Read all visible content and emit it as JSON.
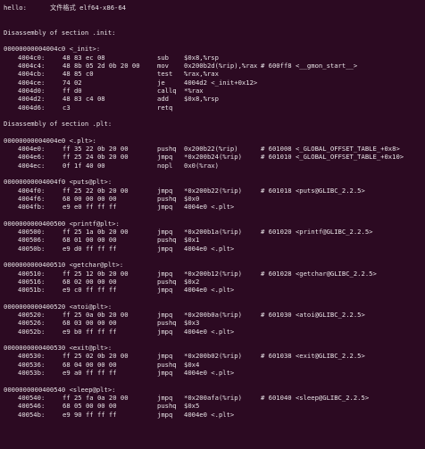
{
  "header": {
    "label": "hello:",
    "value": "文件格式 elf64-x86-64"
  },
  "sections": [
    {
      "title": "Disassembly of section .init:",
      "functions": [
        {
          "header": "00000000004004c0 <_init>:",
          "rows": [
            {
              "addr": "4004c0:",
              "bytes": "48 83 ec 08",
              "mn": "sub",
              "op": "$0x8,%rsp",
              "cm": ""
            },
            {
              "addr": "4004c4:",
              "bytes": "48 8b 05 2d 0b 20 00",
              "mn": "mov",
              "op": "0x200b2d(%rip),%rax",
              "cm": "# 600ff8 <__gmon_start__>"
            },
            {
              "addr": "4004cb:",
              "bytes": "48 85 c0",
              "mn": "test",
              "op": "%rax,%rax",
              "cm": ""
            },
            {
              "addr": "4004ce:",
              "bytes": "74 02",
              "mn": "je",
              "op": "4004d2 <_init+0x12>",
              "cm": ""
            },
            {
              "addr": "4004d0:",
              "bytes": "ff d0",
              "mn": "callq",
              "op": "*%rax",
              "cm": ""
            },
            {
              "addr": "4004d2:",
              "bytes": "48 83 c4 08",
              "mn": "add",
              "op": "$0x8,%rsp",
              "cm": ""
            },
            {
              "addr": "4004d6:",
              "bytes": "c3",
              "mn": "retq",
              "op": "",
              "cm": ""
            }
          ]
        }
      ]
    },
    {
      "title": "Disassembly of section .plt:",
      "functions": [
        {
          "header": "00000000004004e0 <.plt>:",
          "rows": [
            {
              "addr": "4004e0:",
              "bytes": "ff 35 22 0b 20 00",
              "mn": "pushq",
              "op": "0x200b22(%rip)",
              "cm": "# 601008 <_GLOBAL_OFFSET_TABLE_+0x8>"
            },
            {
              "addr": "4004e6:",
              "bytes": "ff 25 24 0b 20 00",
              "mn": "jmpq",
              "op": "*0x200b24(%rip)",
              "cm": "# 601010 <_GLOBAL_OFFSET_TABLE_+0x10>"
            },
            {
              "addr": "4004ec:",
              "bytes": "0f 1f 40 00",
              "mn": "nopl",
              "op": "0x0(%rax)",
              "cm": ""
            }
          ]
        },
        {
          "header": "00000000004004f0 <puts@plt>:",
          "rows": [
            {
              "addr": "4004f0:",
              "bytes": "ff 25 22 0b 20 00",
              "mn": "jmpq",
              "op": "*0x200b22(%rip)",
              "cm": "# 601018 <puts@GLIBC_2.2.5>"
            },
            {
              "addr": "4004f6:",
              "bytes": "68 00 00 00 00",
              "mn": "pushq",
              "op": "$0x0",
              "cm": ""
            },
            {
              "addr": "4004fb:",
              "bytes": "e9 e0 ff ff ff",
              "mn": "jmpq",
              "op": "4004e0 <.plt>",
              "cm": ""
            }
          ]
        },
        {
          "header": "0000000000400500 <printf@plt>:",
          "rows": [
            {
              "addr": "400500:",
              "bytes": "ff 25 1a 0b 20 00",
              "mn": "jmpq",
              "op": "*0x200b1a(%rip)",
              "cm": "# 601020 <printf@GLIBC_2.2.5>"
            },
            {
              "addr": "400506:",
              "bytes": "68 01 00 00 00",
              "mn": "pushq",
              "op": "$0x1",
              "cm": ""
            },
            {
              "addr": "40050b:",
              "bytes": "e9 d0 ff ff ff",
              "mn": "jmpq",
              "op": "4004e0 <.plt>",
              "cm": ""
            }
          ]
        },
        {
          "header": "0000000000400510 <getchar@plt>:",
          "rows": [
            {
              "addr": "400510:",
              "bytes": "ff 25 12 0b 20 00",
              "mn": "jmpq",
              "op": "*0x200b12(%rip)",
              "cm": "# 601028 <getchar@GLIBC_2.2.5>"
            },
            {
              "addr": "400516:",
              "bytes": "68 02 00 00 00",
              "mn": "pushq",
              "op": "$0x2",
              "cm": ""
            },
            {
              "addr": "40051b:",
              "bytes": "e9 c0 ff ff ff",
              "mn": "jmpq",
              "op": "4004e0 <.plt>",
              "cm": ""
            }
          ]
        },
        {
          "header": "0000000000400520 <atoi@plt>:",
          "rows": [
            {
              "addr": "400520:",
              "bytes": "ff 25 0a 0b 20 00",
              "mn": "jmpq",
              "op": "*0x200b0a(%rip)",
              "cm": "# 601030 <atoi@GLIBC_2.2.5>"
            },
            {
              "addr": "400526:",
              "bytes": "68 03 00 00 00",
              "mn": "pushq",
              "op": "$0x3",
              "cm": ""
            },
            {
              "addr": "40052b:",
              "bytes": "e9 b0 ff ff ff",
              "mn": "jmpq",
              "op": "4004e0 <.plt>",
              "cm": ""
            }
          ]
        },
        {
          "header": "0000000000400530 <exit@plt>:",
          "rows": [
            {
              "addr": "400530:",
              "bytes": "ff 25 02 0b 20 00",
              "mn": "jmpq",
              "op": "*0x200b02(%rip)",
              "cm": "# 601038 <exit@GLIBC_2.2.5>"
            },
            {
              "addr": "400536:",
              "bytes": "68 04 00 00 00",
              "mn": "pushq",
              "op": "$0x4",
              "cm": ""
            },
            {
              "addr": "40053b:",
              "bytes": "e9 a0 ff ff ff",
              "mn": "jmpq",
              "op": "4004e0 <.plt>",
              "cm": ""
            }
          ]
        },
        {
          "header": "0000000000400540 <sleep@plt>:",
          "rows": [
            {
              "addr": "400540:",
              "bytes": "ff 25 fa 0a 20 00",
              "mn": "jmpq",
              "op": "*0x200afa(%rip)",
              "cm": "# 601040 <sleep@GLIBC_2.2.5>"
            },
            {
              "addr": "400546:",
              "bytes": "68 05 00 00 00",
              "mn": "pushq",
              "op": "$0x5",
              "cm": ""
            },
            {
              "addr": "40054b:",
              "bytes": "e9 90 ff ff ff",
              "mn": "jmpq",
              "op": "4004e0 <.plt>",
              "cm": ""
            }
          ]
        }
      ]
    }
  ]
}
